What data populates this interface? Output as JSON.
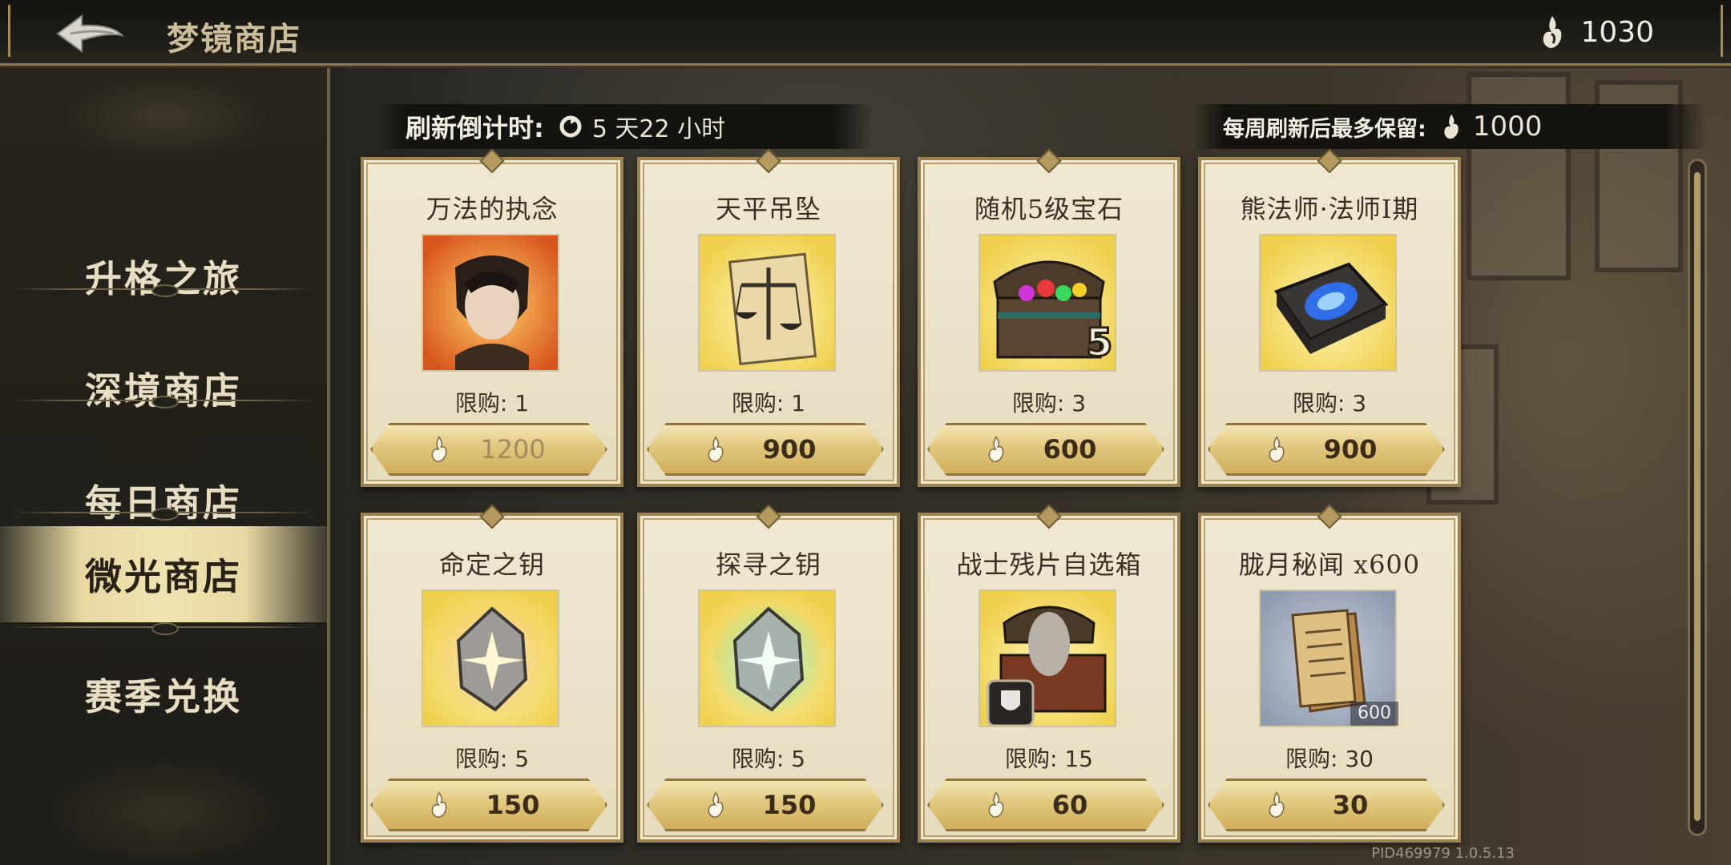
{
  "header": {
    "title": "梦镜商店",
    "currency_value": "1030"
  },
  "sidebar": {
    "items": [
      {
        "label": "升格之旅"
      },
      {
        "label": "深境商店"
      },
      {
        "label": "每日商店"
      },
      {
        "label": "微光商店",
        "active": true
      },
      {
        "label": "赛季兑换"
      }
    ]
  },
  "refresh": {
    "label": "刷新倒计时:",
    "value": "5 天22 小时"
  },
  "weekly_cap": {
    "label": "每周刷新后最多保留:",
    "value": "1000"
  },
  "items": [
    {
      "name": "万法的执念",
      "limit": "限购: 1",
      "price": "1200",
      "disabled": true,
      "icon": "hero-portrait-icon"
    },
    {
      "name": "天平吊坠",
      "limit": "限购: 1",
      "price": "900",
      "icon": "scales-pendant-icon"
    },
    {
      "name": "随机5级宝石",
      "limit": "限购: 3",
      "price": "600",
      "icon": "gem-chest-icon",
      "badge": "5"
    },
    {
      "name": "熊法师·法师I期",
      "limit": "限购: 3",
      "price": "900",
      "icon": "tome-icon"
    },
    {
      "name": "命定之钥",
      "limit": "限购: 5",
      "price": "150",
      "icon": "golden-key-crystal-icon"
    },
    {
      "name": "探寻之钥",
      "limit": "限购: 5",
      "price": "150",
      "icon": "green-key-crystal-icon"
    },
    {
      "name": "战士残片自选箱",
      "limit": "限购: 15",
      "price": "60",
      "icon": "warrior-chest-icon"
    },
    {
      "name": "胧月秘闻 x600",
      "limit": "限购: 30",
      "price": "30",
      "icon": "scroll-icon",
      "badge": "600"
    }
  ],
  "footer": {
    "pid": "PID469979  1.0.5.13"
  },
  "colors": {
    "accent_gold": "#cfae5c",
    "card_bg": "#efe8d3",
    "active_tab": "#efe3b0"
  }
}
